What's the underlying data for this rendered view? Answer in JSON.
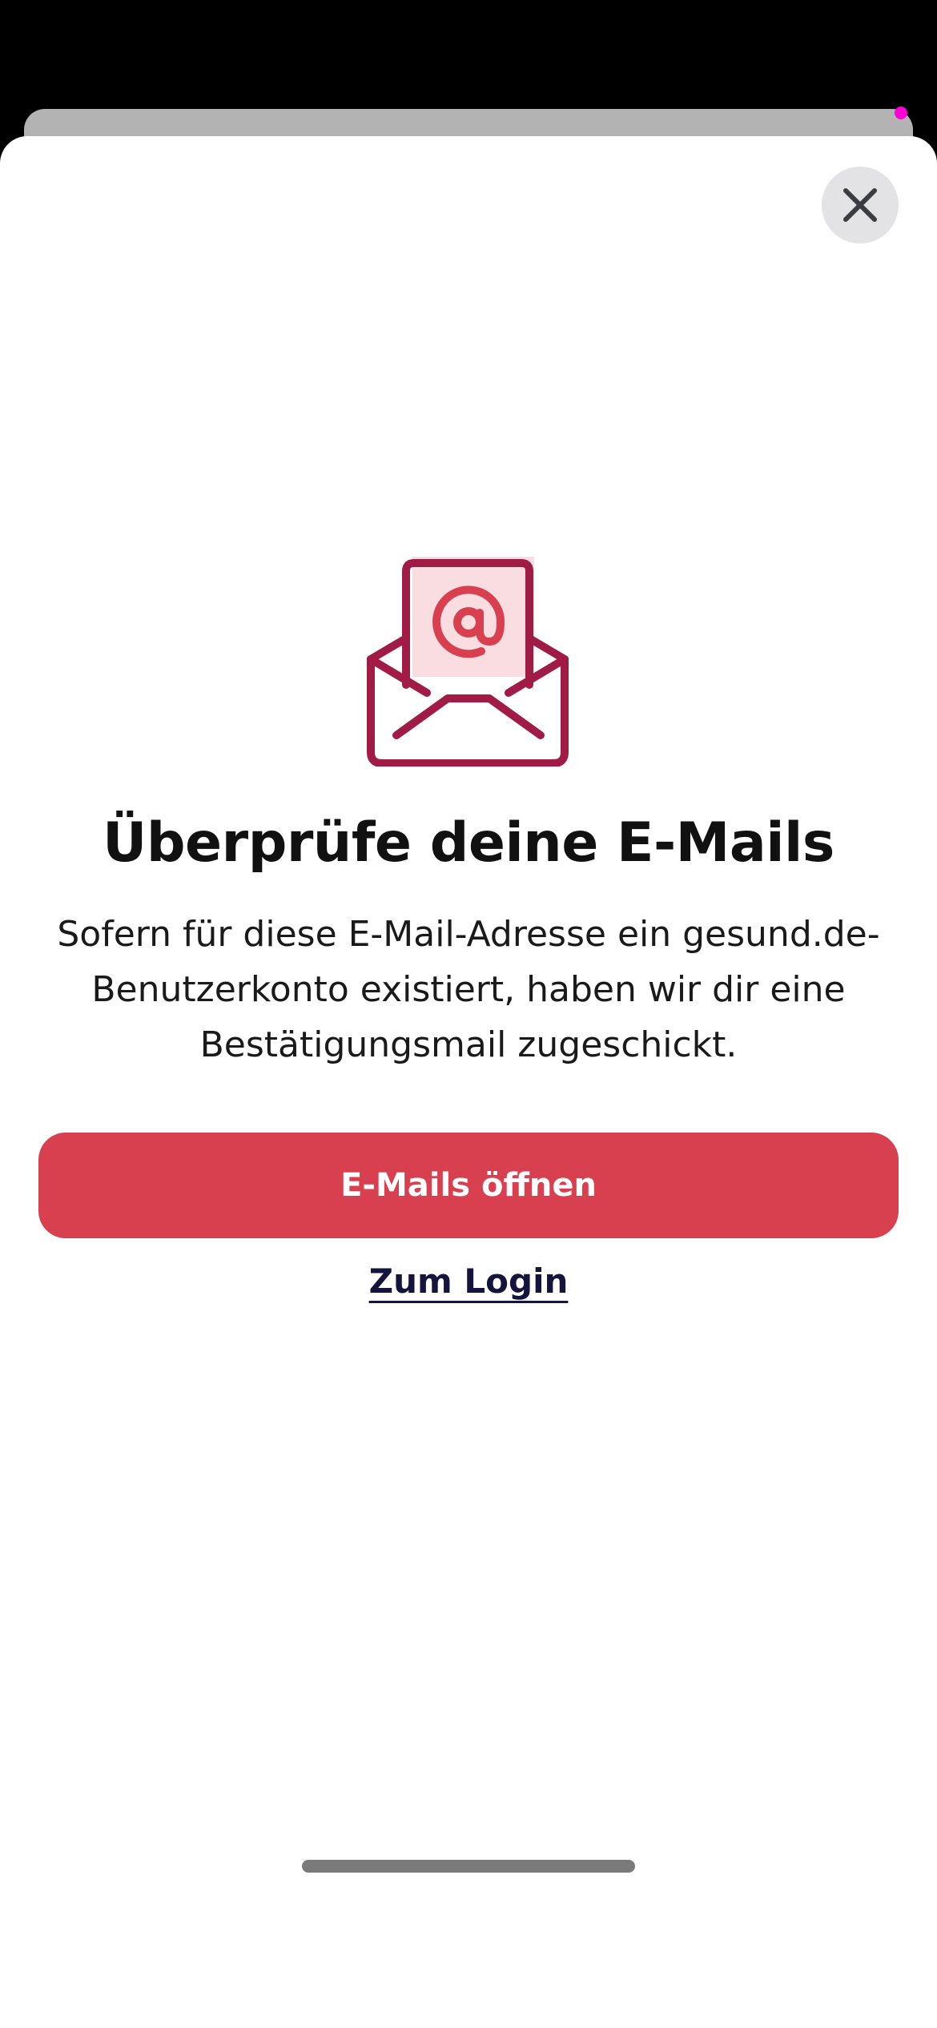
{
  "colors": {
    "accent": "#d84050",
    "illustration_stroke": "#a01c47",
    "illustration_fill": "#f9dde0",
    "link_color": "#14143c",
    "indicator_dot": "#ff00d8"
  },
  "header": {
    "close_icon": "close-icon"
  },
  "main": {
    "illustration_icon": "envelope-at-icon",
    "title": "Überprüfe deine E-Mails",
    "description": "Sofern für diese E-Mail-Adresse ein gesund.de-Benutzerkonto existiert, haben wir dir eine Bestätigungsmail zugeschickt.",
    "primary_button_label": "E-Mails öffnen",
    "login_link_label": "Zum Login"
  }
}
